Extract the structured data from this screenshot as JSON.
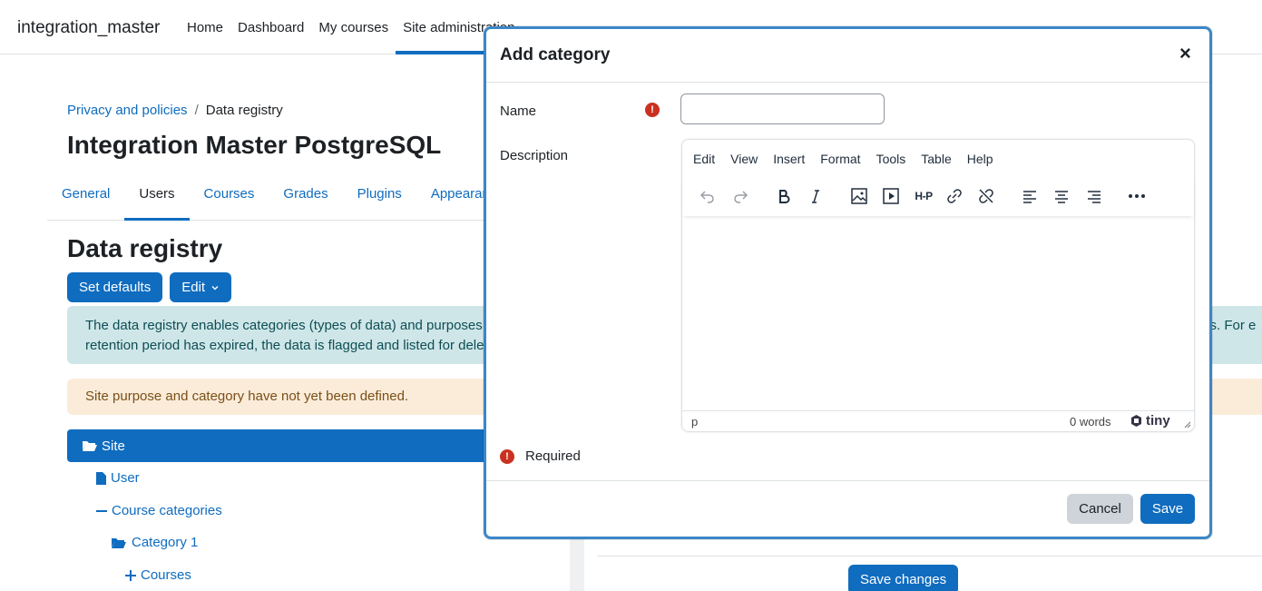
{
  "navbar": {
    "site_name": "integration_master",
    "links": [
      "Home",
      "Dashboard",
      "My courses",
      "Site administration"
    ]
  },
  "breadcrumb": {
    "parent": "Privacy and policies",
    "separator": "/",
    "current": "Data registry"
  },
  "page_title": "Integration Master PostgreSQL",
  "tabs": [
    "General",
    "Users",
    "Courses",
    "Grades",
    "Plugins",
    "Appearance"
  ],
  "active_tab": "Users",
  "section_title": "Data registry",
  "buttons": {
    "set_defaults": "Set defaults",
    "edit": "Edit",
    "save_changes": "Save changes"
  },
  "info_text_line1": "The data registry enables categories (types of data) and purposes",
  "info_text_line1_end": "ks. For e",
  "info_text_line2": "retention period has expired, the data is flagged and listed for dele",
  "warning_text": "Site purpose and category have not yet been defined.",
  "tree": {
    "site": "Site",
    "user": "User",
    "course_categories": "Course categories",
    "category1": "Category 1",
    "courses": "Courses"
  },
  "modal": {
    "title": "Add category",
    "close_symbol": "×",
    "name_label": "Name",
    "name_value": "",
    "description_label": "Description",
    "required_symbol": "!",
    "required_text": "Required",
    "cancel": "Cancel",
    "save": "Save"
  },
  "editor": {
    "menus": [
      "Edit",
      "View",
      "Insert",
      "Format",
      "Tools",
      "Table",
      "Help"
    ],
    "status_path": "p",
    "word_count": "0 words",
    "brand": "tiny",
    "h5p_label": "H-P"
  },
  "colors": {
    "primary": "#0f6cbf",
    "danger": "#ca3120",
    "info_bg": "#cfe6e8",
    "warn_bg": "#fbecda"
  }
}
